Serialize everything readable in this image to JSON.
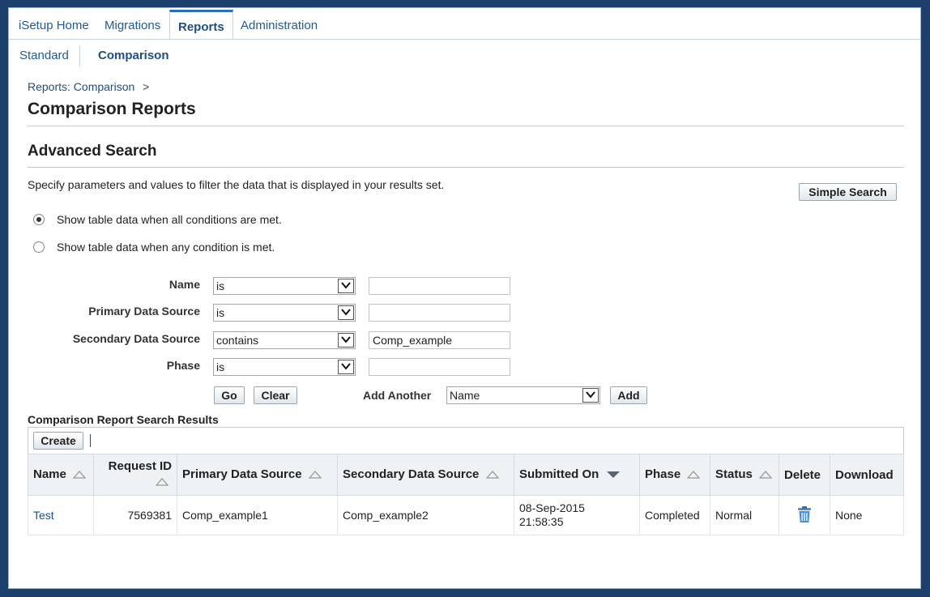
{
  "tabs": [
    {
      "label": "iSetup Home"
    },
    {
      "label": "Migrations"
    },
    {
      "label": "Reports"
    },
    {
      "label": "Administration"
    }
  ],
  "subtabs": [
    {
      "label": "Standard"
    },
    {
      "label": "Comparison"
    }
  ],
  "breadcrumb": {
    "link": "Reports: Comparison",
    "sep": ">"
  },
  "page_title": "Comparison Reports",
  "search": {
    "title": "Advanced Search",
    "instructions": "Specify parameters and values to filter the data that is displayed in your results set.",
    "simple_search_label": "Simple Search",
    "match_all_label": "Show table data when all conditions are met.",
    "match_any_label": "Show table data when any condition is met.",
    "criteria": [
      {
        "label": "Name",
        "operator": "is",
        "value": ""
      },
      {
        "label": "Primary Data Source",
        "operator": "is",
        "value": ""
      },
      {
        "label": "Secondary Data Source",
        "operator": "contains",
        "value": "Comp_example"
      },
      {
        "label": "Phase",
        "operator": "is",
        "value": ""
      }
    ],
    "go_label": "Go",
    "clear_label": "Clear",
    "add_another_label": "Add Another",
    "add_another_value": "Name",
    "add_label": "Add"
  },
  "results": {
    "title": "Comparison Report Search Results",
    "create_label": "Create",
    "columns": {
      "name": "Name",
      "request_id": "Request ID",
      "primary": "Primary Data Source",
      "secondary": "Secondary Data Source",
      "submitted": "Submitted On",
      "phase": "Phase",
      "status": "Status",
      "delete": "Delete",
      "download": "Download"
    },
    "rows": [
      {
        "name": "Test",
        "request_id": "7569381",
        "primary": "Comp_example1",
        "secondary": "Comp_example2",
        "submitted_date": "08-Sep-2015",
        "submitted_time": "21:58:35",
        "phase": "Completed",
        "status": "Normal",
        "download": "None"
      }
    ]
  },
  "colors": {
    "accent": "#2a6fbf",
    "link": "#1f4e86",
    "header_bg": "#eef2f5",
    "page_border": "#1c3f6b"
  }
}
